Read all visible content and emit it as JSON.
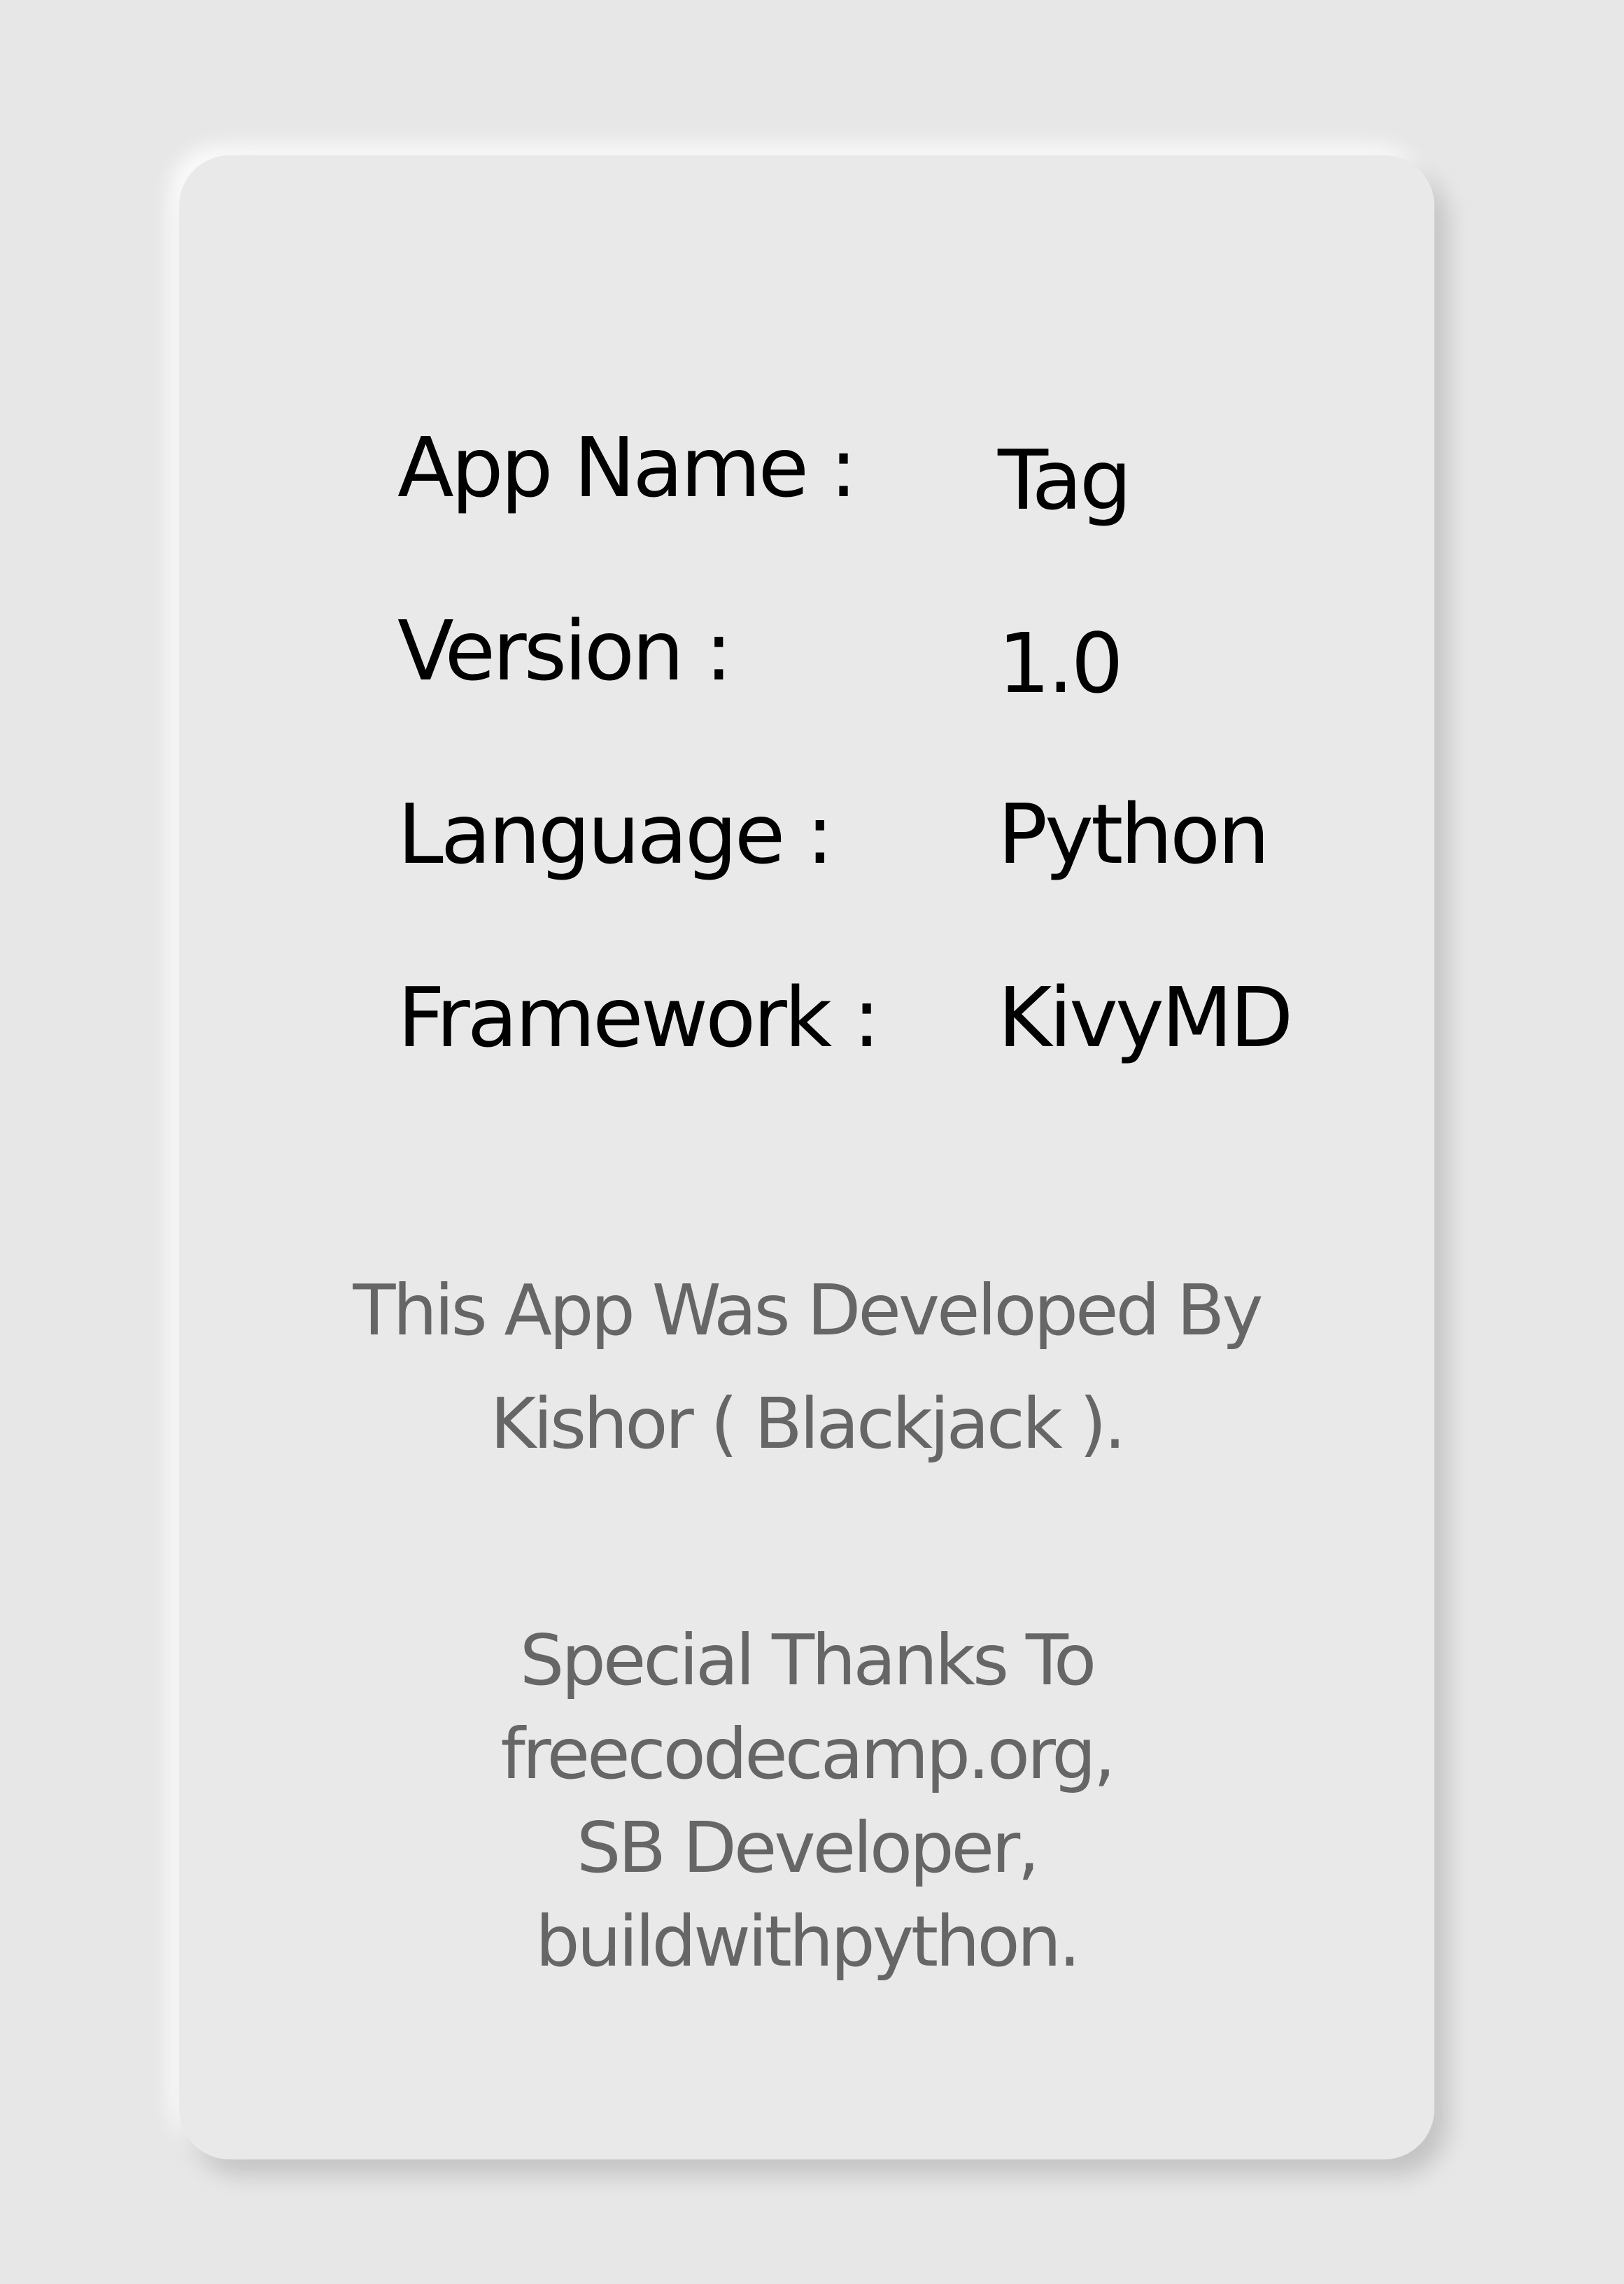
{
  "info": {
    "app_name": {
      "label": "App Name :",
      "value": "Tag"
    },
    "version": {
      "label": "Version :",
      "value": "1.0"
    },
    "language": {
      "label": "Language :",
      "value": "Python"
    },
    "framework": {
      "label": "Framework :",
      "value": "KivyMD"
    }
  },
  "credits": {
    "developer_line1": "This App Was Developed By",
    "developer_line2": "Kishor ( Blackjack ).",
    "thanks_lines": [
      "Special Thanks To",
      "freecodecamp.org,",
      "SB Developer,",
      "buildwithpython."
    ]
  },
  "colors": {
    "background": "#e7e7e7",
    "card": "#e9e9e9",
    "primary_text": "#000000",
    "secondary_text": "#666666"
  }
}
